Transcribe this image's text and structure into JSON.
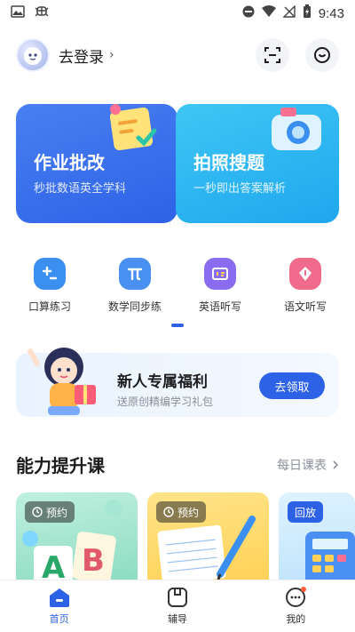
{
  "status_bar": {
    "time": "9:43"
  },
  "header": {
    "login_label": "去登录",
    "chevron": "›"
  },
  "hero": [
    {
      "title": "作业批改",
      "subtitle": "秒批数语英全学科"
    },
    {
      "title": "拍照搜题",
      "subtitle": "一秒即出答案解析"
    }
  ],
  "tools": [
    {
      "label": "口算练习",
      "color": "#3b8ff0"
    },
    {
      "label": "数学同步练",
      "color": "#4a8ff2"
    },
    {
      "label": "英语听写",
      "color": "#8a6cf0"
    },
    {
      "label": "语文听写",
      "color": "#f06a8c"
    }
  ],
  "banner": {
    "title": "新人专属福利",
    "subtitle": "送原创精编学习礼包",
    "button": "去领取"
  },
  "section": {
    "title": "能力提升课",
    "more": "每日课表"
  },
  "courses": [
    {
      "badge": "预约"
    },
    {
      "badge": "预约"
    },
    {
      "badge": "回放"
    }
  ],
  "nav": [
    {
      "label": "首页",
      "active": true
    },
    {
      "label": "辅导"
    },
    {
      "label": "我的"
    }
  ],
  "colors": {
    "accent": "#2d62e6",
    "hero_blue": "#3a70ec",
    "hero_cyan": "#2bb5f1"
  }
}
